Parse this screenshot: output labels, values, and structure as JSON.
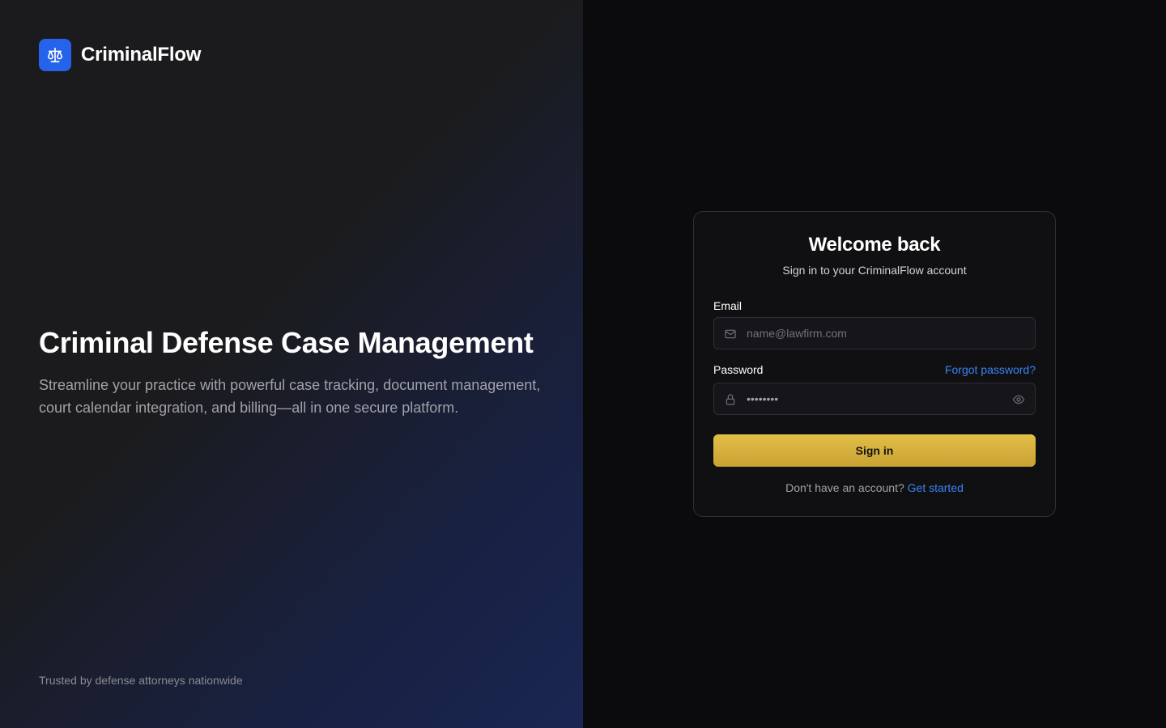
{
  "brand": {
    "name": "CriminalFlow",
    "logo_icon": "scales-icon",
    "accent": "#2563eb"
  },
  "hero": {
    "title": "Criminal Defense Case Management",
    "description": "Streamline your practice with powerful case tracking, document management, court calendar integration, and billing—all in one secure platform."
  },
  "trust_text": "Trusted by defense attorneys nationwide",
  "login": {
    "title": "Welcome back",
    "subtitle": "Sign in to your CriminalFlow account",
    "email_label": "Email",
    "email_placeholder": "name@lawfirm.com",
    "email_icon": "mail-icon",
    "password_label": "Password",
    "forgot_link": "Forgot password?",
    "password_value": "••••••••",
    "password_icon": "lock-icon",
    "show_password_icon": "eye-icon",
    "submit_label": "Sign in",
    "signup_prompt": "Don't have an account?",
    "signup_link": "Get started",
    "button_color": "#d4af37",
    "link_color": "#3b82f6"
  }
}
